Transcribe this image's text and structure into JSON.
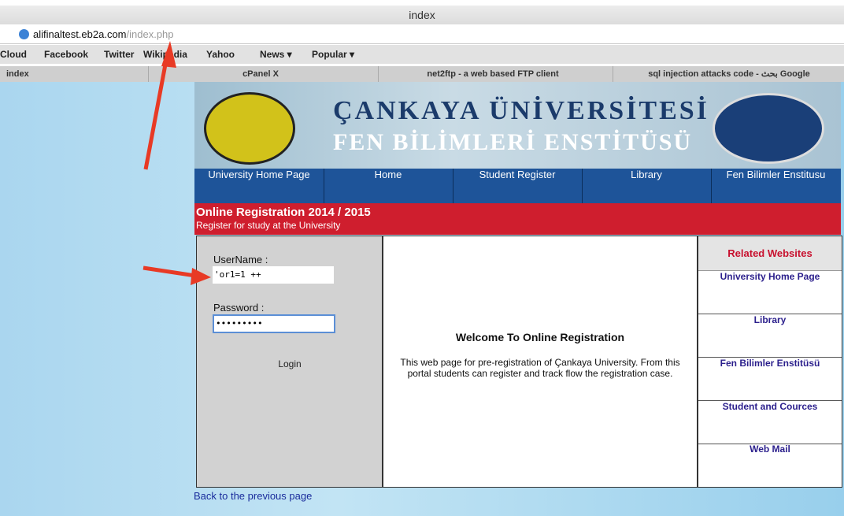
{
  "window": {
    "title": "index"
  },
  "address": {
    "host": "alifinaltest.eb2a.com",
    "path": "/index.php"
  },
  "bookmarks": [
    "Cloud",
    "Facebook",
    "Twitter",
    "Wikipedia",
    "Yahoo",
    "News ▾",
    "Popular ▾"
  ],
  "tabs": [
    "index",
    "cPanel X",
    "net2ftp - a web based FTP client",
    "sql injection attacks code - بحث Google"
  ],
  "banner": {
    "line1": "ÇANKAYA ÜNİVERSİTESİ",
    "line2": "FEN BİLİMLERİ ENSTİTÜSÜ"
  },
  "nav": [
    "University Home Page",
    "Home",
    "Student Register",
    "Library",
    "Fen Bilimler Enstitusu"
  ],
  "registration": {
    "heading": "Online Registration 2014 / 2015",
    "subheading": "Register for study at the University"
  },
  "login": {
    "username_label": "UserName :",
    "username_value": "'or1=1 ++",
    "password_label": "Password   :",
    "password_value": "•••••••••",
    "button": "Login"
  },
  "welcome": {
    "title": "Welcome To Online Registration",
    "body": "This web page for pre-registration of Çankaya University. From this portal students can register and track flow the registration case."
  },
  "related": {
    "heading": "Related Websites",
    "links": [
      "University Home Page",
      "Library",
      "Fen Bilimler Enstitüsü",
      "Student and Cources",
      "Web Mail"
    ]
  },
  "footer": {
    "back_link": "Back to the previous page"
  }
}
